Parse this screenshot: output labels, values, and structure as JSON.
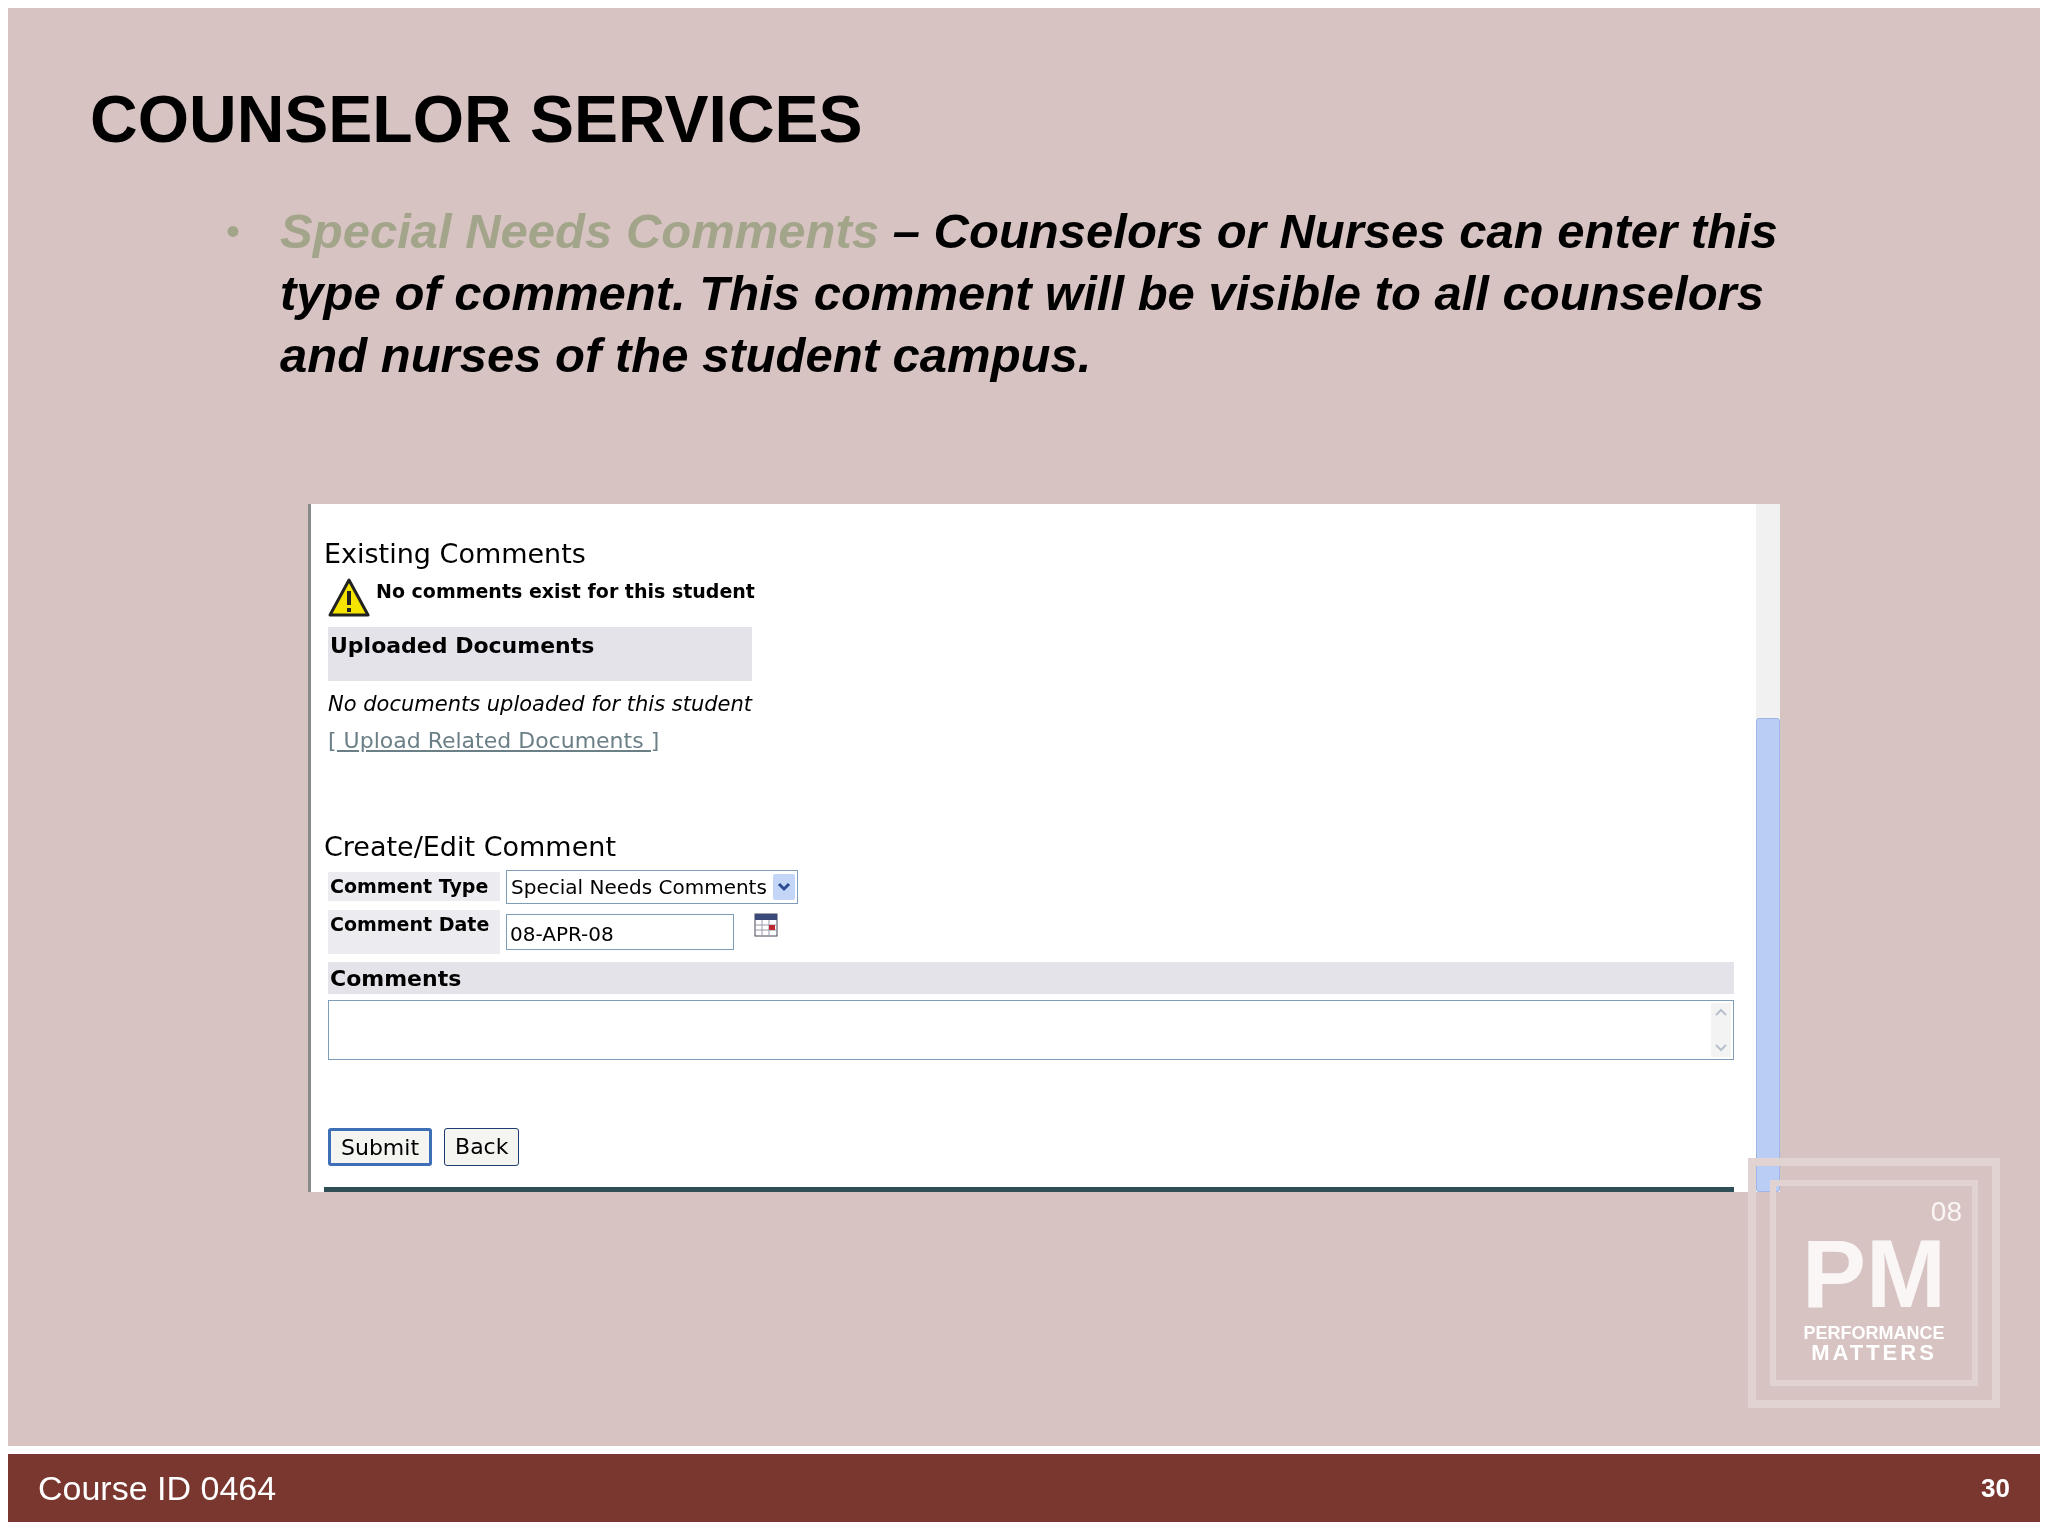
{
  "slide": {
    "title": "COUNSELOR SERVICES",
    "bullets": [
      {
        "marker": "•",
        "term": "Special Needs Comments",
        "text": "– Counselors or Nurses can enter this type of comment. This comment will be visible to all counselors and nurses of the student campus."
      }
    ]
  },
  "screenshot": {
    "existing_heading": "Existing Comments",
    "warning": "No comments exist for this student",
    "uploaded_header": "Uploaded Documents",
    "uploaded_empty": "No documents uploaded for this student",
    "upload_link": "[ Upload Related Documents ]",
    "create_heading": "Create/Edit Comment",
    "comment_type": {
      "label": "Comment Type",
      "value": "Special Needs Comments"
    },
    "comment_date": {
      "label": "Comment Date",
      "value": "08-APR-08"
    },
    "comments": {
      "label": "Comments"
    },
    "buttons": [
      {
        "label": "Submit",
        "selected": true
      },
      {
        "label": "Back",
        "selected": false
      }
    ]
  },
  "logo": {
    "year": "08",
    "letters": "PM",
    "line1": "PERFORMANCE",
    "line2": "MATTERS"
  },
  "footer": {
    "course": "Course ID 0464",
    "page": "30"
  }
}
